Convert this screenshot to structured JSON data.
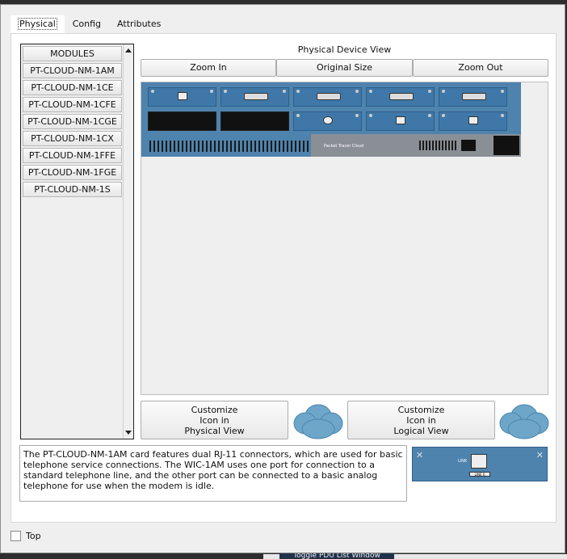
{
  "tabs": [
    {
      "label": "Physical",
      "active": true
    },
    {
      "label": "Config",
      "active": false
    },
    {
      "label": "Attributes",
      "active": false
    }
  ],
  "modules": {
    "header": "MODULES",
    "items": [
      "PT-CLOUD-NM-1AM",
      "PT-CLOUD-NM-1CE",
      "PT-CLOUD-NM-1CFE",
      "PT-CLOUD-NM-1CGE",
      "PT-CLOUD-NM-1CX",
      "PT-CLOUD-NM-1FFE",
      "PT-CLOUD-NM-1FGE",
      "PT-CLOUD-NM-1S"
    ]
  },
  "physical_view": {
    "title": "Physical Device View",
    "zoom_in": "Zoom In",
    "original_size": "Original Size",
    "zoom_out": "Zoom Out",
    "device_label": "Packet Tracer Cloud"
  },
  "customize": {
    "physical_line1": "Customize",
    "physical_line2": "Icon in",
    "physical_line3": "Physical View",
    "logical_line1": "Customize",
    "logical_line2": "Icon in",
    "logical_line3": "Logical View"
  },
  "description": "The PT-CLOUD-NM-1AM card features dual RJ-11 connectors, which are used for basic telephone service connections. The WIC-1AM uses one port for connection to a standard telephone line, and the other port can be connected to a basic analog telephone for use when the modem is idle.",
  "thumbnail": {
    "link_text": "LINK",
    "port_label": "LINE 0"
  },
  "top_checkbox": {
    "label": "Top",
    "checked": false
  },
  "taskbar": {
    "button_label": "Toggle PDU List Window"
  },
  "colors": {
    "device_blue": "#4e83ae",
    "tab_accent": "#2a6fb5",
    "cloud": "#6da6c8"
  }
}
